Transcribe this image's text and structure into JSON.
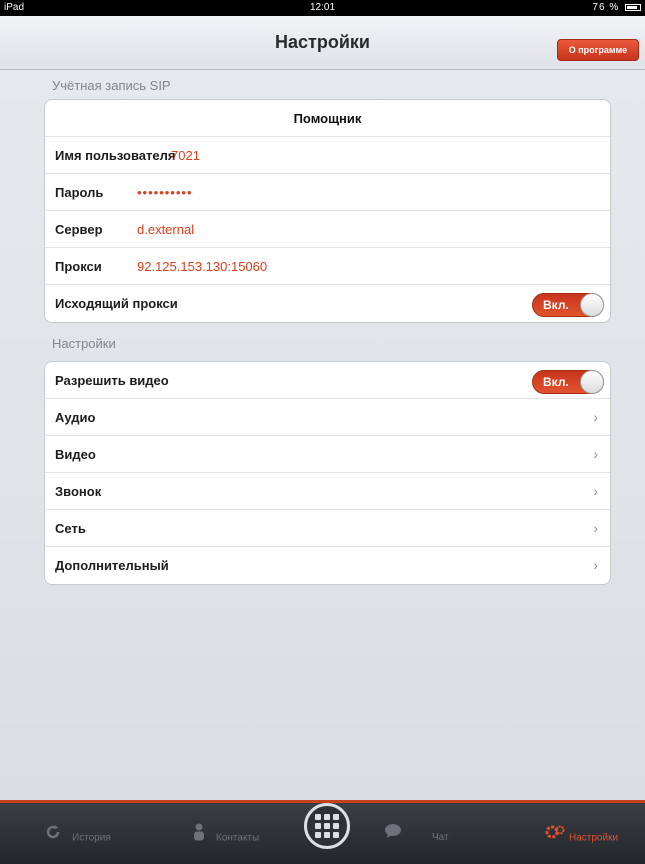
{
  "status": {
    "left": "iPad",
    "time": "12:01",
    "battery": "76 %"
  },
  "nav": {
    "title": "Настройки",
    "about_button": "О программе"
  },
  "sip_section": {
    "header": "Учётная запись SIP",
    "wizard": "Помощник",
    "username_label": "Имя пользователя",
    "username_value": "7021",
    "password_label": "Пароль",
    "password_value": "••••••••••",
    "server_label": "Сервер",
    "server_value": "d.external",
    "proxy_label": "Прокси",
    "proxy_value": "92.125.153.130:15060",
    "outbound_proxy_label": "Исходящий прокси",
    "outbound_proxy_toggle": "Вкл."
  },
  "settings_section": {
    "header": "Настройки",
    "enable_video_label": "Разрешить видео",
    "enable_video_toggle": "Вкл.",
    "items": [
      {
        "label": "Аудио"
      },
      {
        "label": "Видео"
      },
      {
        "label": "Звонок"
      },
      {
        "label": "Сеть"
      },
      {
        "label": "Дополнительный"
      }
    ]
  },
  "tabbar": {
    "history": "История",
    "contacts": "Контакты",
    "chat": "Чат",
    "settings": "Настройки"
  },
  "colors": {
    "accent": "#d8401f",
    "tabbar": "#2b2e33"
  }
}
